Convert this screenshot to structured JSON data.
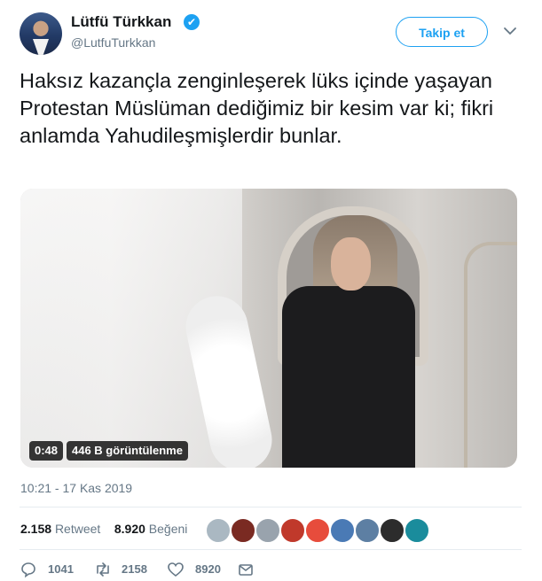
{
  "author": {
    "name": "Lütfü Türkkan",
    "handle": "@LutfuTurkkan",
    "verified_glyph": "✔",
    "follow_label": "Takip et"
  },
  "tweet": {
    "text": "Haksız kazançla zenginleşerek lüks içinde yaşayan Protestan Müslüman dediğimiz bir kesim var ki; fikri anlamda Yahudileşmişlerdir bunlar.",
    "timestamp": "10:21 - 17 Kas 2019"
  },
  "media": {
    "duration": "0:48",
    "views": "446 B görüntülenme"
  },
  "stats": {
    "retweets": "2.158",
    "retweet_label": "Retweet",
    "likes": "8.920",
    "like_label": "Beğeni"
  },
  "likers": [
    {
      "color": "#aab8c2"
    },
    {
      "color": "#7a2a22"
    },
    {
      "color": "#99a3ad"
    },
    {
      "color": "#c0392b"
    },
    {
      "color": "#e74c3c"
    },
    {
      "color": "#4a7ab5"
    },
    {
      "color": "#5d7fa3"
    },
    {
      "color": "#2c2c2c"
    },
    {
      "color": "#1a8c9c"
    }
  ],
  "actions": {
    "replies": "1041",
    "retweets": "2158",
    "likes": "8920"
  },
  "colors": {
    "accent": "#1da1f2",
    "muted": "#657786"
  }
}
